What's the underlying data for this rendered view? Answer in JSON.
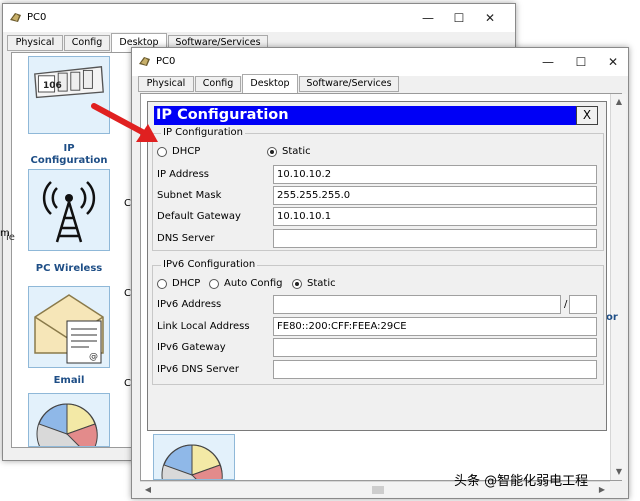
{
  "back_window": {
    "title": "PC0",
    "tabs": [
      "Physical",
      "Config",
      "Desktop",
      "Software/Services"
    ],
    "icons": [
      {
        "label": "IP Configuration",
        "badge": "106"
      },
      {
        "label": "PC Wireless"
      },
      {
        "label": "Email"
      }
    ],
    "partial_text": {
      "left_m": "m",
      "right_or": "or",
      "left_ie": "ie",
      "c1": "C",
      "c2": "C",
      "c3": "C"
    }
  },
  "front_window": {
    "title": "PC0",
    "tabs": [
      "Physical",
      "Config",
      "Desktop",
      "Software/Services"
    ]
  },
  "window_controls": {
    "minimize": "—",
    "maximize": "☐",
    "close": "✕"
  },
  "ip_config": {
    "title": "IP Configuration",
    "close": "X",
    "ipv4": {
      "legend": "IP Configuration",
      "dhcp": "DHCP",
      "static": "Static",
      "selected": "Static",
      "fields": {
        "ip_address": {
          "label": "IP Address",
          "value": "10.10.10.2"
        },
        "subnet_mask": {
          "label": "Subnet Mask",
          "value": "255.255.255.0"
        },
        "default_gateway": {
          "label": "Default Gateway",
          "value": "10.10.10.1"
        },
        "dns_server": {
          "label": "DNS Server",
          "value": ""
        }
      }
    },
    "ipv6": {
      "legend": "IPv6 Configuration",
      "dhcp": "DHCP",
      "auto": "Auto Config",
      "static": "Static",
      "selected": "Static",
      "slash": "/",
      "fields": {
        "address": {
          "label": "IPv6 Address",
          "value": "",
          "prefix": ""
        },
        "link_local": {
          "label": "Link Local Address",
          "value": "FE80::200:CFF:FEEA:29CE"
        },
        "gateway": {
          "label": "IPv6 Gateway",
          "value": ""
        },
        "dns_server": {
          "label": "IPv6 DNS Server",
          "value": ""
        }
      }
    }
  },
  "watermark": "头条 @智能化弱电工程",
  "colors": {
    "title_blue": "#0000f6",
    "arrow_red": "#e02020",
    "icon_label": "#1e4e86"
  },
  "icons": [
    "computer-icon",
    "arrow-pointer-icon",
    "wireless-tower-icon",
    "envelope-icon",
    "pie-chart-icon"
  ]
}
